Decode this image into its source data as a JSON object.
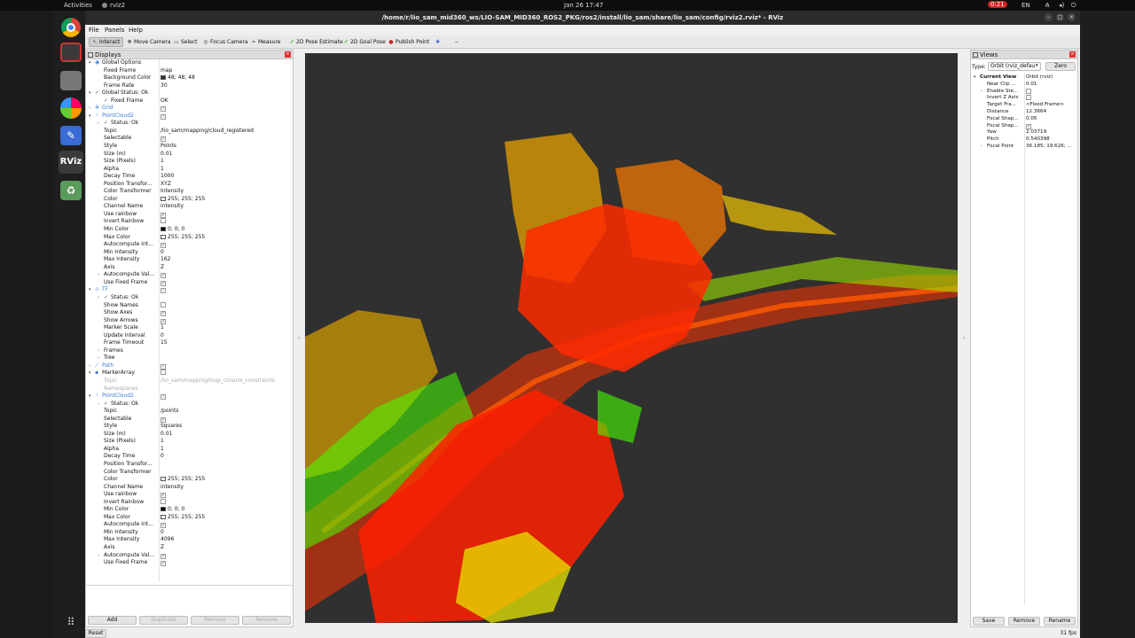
{
  "system": {
    "activities": "Activities",
    "app_name": "rviz2",
    "datetime": "Jan 26  17:47",
    "recording": "0:21",
    "language": "EN"
  },
  "window": {
    "title": "/home/r/lio_sam_mid360_ws/LIO-SAM_MID360_ROS2_PKG/ros2/install/lio_sam/share/lio_sam/config/rviz2.rviz* - RViz"
  },
  "menu": [
    "File",
    "Panels",
    "Help"
  ],
  "toolbar": [
    {
      "label": "Interact",
      "icon": "interact-icon",
      "active": true
    },
    {
      "label": "Move Camera",
      "icon": "move-camera-icon",
      "active": false
    },
    {
      "label": "Select",
      "icon": "select-icon",
      "active": false
    },
    {
      "label": "Focus Camera",
      "icon": "focus-camera-icon",
      "active": false
    },
    {
      "label": "Measure",
      "icon": "measure-icon",
      "active": false
    },
    {
      "label": "2D Pose Estimate",
      "icon": "pose-estimate-icon",
      "active": false
    },
    {
      "label": "2D Goal Pose",
      "icon": "goal-pose-icon",
      "active": false
    },
    {
      "label": "Publish Point",
      "icon": "publish-point-icon",
      "active": false
    }
  ],
  "displays": {
    "title": "Displays",
    "rows": [
      {
        "d": 0,
        "exp": "v",
        "icon": "globe-icon",
        "k": "Global Options",
        "v": ""
      },
      {
        "d": 1,
        "k": "Fixed Frame",
        "v": "map"
      },
      {
        "d": 1,
        "k": "Background Color",
        "v": "48; 48; 48",
        "sw": "#303030"
      },
      {
        "d": 1,
        "k": "Frame Rate",
        "v": "30"
      },
      {
        "d": 0,
        "exp": "v",
        "icon": "check-icon",
        "k": "Global Status: Ok",
        "v": ""
      },
      {
        "d": 1,
        "icon": "check-icon",
        "k": "Fixed Frame",
        "v": "OK"
      },
      {
        "d": 0,
        "exp": ">",
        "icon": "grid-icon",
        "k": "Grid",
        "v": "",
        "blue": true,
        "chk": true
      },
      {
        "d": 0,
        "exp": "v",
        "icon": "pointcloud-icon",
        "k": "PointCloud2",
        "v": "",
        "blue": true,
        "chk": true
      },
      {
        "d": 1,
        "exp": ">",
        "icon": "check-icon",
        "k": "Status: Ok",
        "v": ""
      },
      {
        "d": 1,
        "k": "Topic",
        "v": "/lio_sam/mapping/cloud_registered"
      },
      {
        "d": 1,
        "k": "Selectable",
        "v": "",
        "chk": true
      },
      {
        "d": 1,
        "k": "Style",
        "v": "Points"
      },
      {
        "d": 1,
        "k": "Size (m)",
        "v": "0.01"
      },
      {
        "d": 1,
        "k": "Size (Pixels)",
        "v": "1"
      },
      {
        "d": 1,
        "k": "Alpha",
        "v": "1"
      },
      {
        "d": 1,
        "k": "Decay Time",
        "v": "1000"
      },
      {
        "d": 1,
        "k": "Position Transfor...",
        "v": "XYZ"
      },
      {
        "d": 1,
        "k": "Color Transformer",
        "v": "Intensity"
      },
      {
        "d": 1,
        "k": "Color",
        "v": "255; 255; 255",
        "sw": "#ffffff"
      },
      {
        "d": 1,
        "k": "Channel Name",
        "v": "intensity"
      },
      {
        "d": 1,
        "k": "Use rainbow",
        "v": "",
        "chk": true
      },
      {
        "d": 1,
        "k": "Invert Rainbow",
        "v": "",
        "chk": false
      },
      {
        "d": 1,
        "k": "Min Color",
        "v": "0; 0; 0",
        "sw": "#000000"
      },
      {
        "d": 1,
        "k": "Max Color",
        "v": "255; 255; 255",
        "sw": "#ffffff"
      },
      {
        "d": 1,
        "k": "Autocompute Int...",
        "v": "",
        "chk": true
      },
      {
        "d": 1,
        "k": "Min Intensity",
        "v": "0"
      },
      {
        "d": 1,
        "k": "Max Intensity",
        "v": "162"
      },
      {
        "d": 1,
        "k": "Axis",
        "v": "Z"
      },
      {
        "d": 1,
        "exp": ">",
        "k": "Autocompute Val...",
        "v": "",
        "chk": true
      },
      {
        "d": 1,
        "k": "Use Fixed Frame",
        "v": "",
        "chk": true
      },
      {
        "d": 0,
        "exp": "v",
        "icon": "tf-icon",
        "k": "TF",
        "v": "",
        "blue": true,
        "chk": true
      },
      {
        "d": 1,
        "exp": ">",
        "icon": "check-icon",
        "k": "Status: Ok",
        "v": ""
      },
      {
        "d": 1,
        "k": "Show Names",
        "v": "",
        "chk": false
      },
      {
        "d": 1,
        "k": "Show Axes",
        "v": "",
        "chk": true
      },
      {
        "d": 1,
        "k": "Show Arrows",
        "v": "",
        "chk": true
      },
      {
        "d": 1,
        "k": "Marker Scale",
        "v": "1"
      },
      {
        "d": 1,
        "k": "Update Interval",
        "v": "0"
      },
      {
        "d": 1,
        "k": "Frame Timeout",
        "v": "15"
      },
      {
        "d": 1,
        "exp": ">",
        "k": "Frames",
        "v": ""
      },
      {
        "d": 1,
        "exp": ">",
        "k": "Tree",
        "v": ""
      },
      {
        "d": 0,
        "exp": ">",
        "icon": "path-icon",
        "k": "Path",
        "v": "",
        "blue": true,
        "chk": true
      },
      {
        "d": 0,
        "exp": "v",
        "icon": "marker-icon",
        "k": "MarkerArray",
        "v": "",
        "chk": false
      },
      {
        "d": 1,
        "k": "Topic",
        "v": "/lio_sam/mapping/loop_closure_constraints",
        "gray": true
      },
      {
        "d": 1,
        "k": "Namespaces",
        "v": "",
        "gray": true
      },
      {
        "d": 0,
        "exp": "v",
        "icon": "pointcloud-icon",
        "k": "PointCloud2",
        "v": "",
        "blue": true,
        "chk": true
      },
      {
        "d": 1,
        "exp": ">",
        "icon": "check-icon",
        "k": "Status: Ok",
        "v": ""
      },
      {
        "d": 1,
        "k": "Topic",
        "v": "/points"
      },
      {
        "d": 1,
        "k": "Selectable",
        "v": "",
        "chk": true
      },
      {
        "d": 1,
        "k": "Style",
        "v": "Squares"
      },
      {
        "d": 1,
        "k": "Size (m)",
        "v": "0.01"
      },
      {
        "d": 1,
        "k": "Size (Pixels)",
        "v": "1"
      },
      {
        "d": 1,
        "k": "Alpha",
        "v": "1"
      },
      {
        "d": 1,
        "k": "Decay Time",
        "v": "0"
      },
      {
        "d": 1,
        "k": "Position Transfor...",
        "v": ""
      },
      {
        "d": 1,
        "k": "Color Transformer",
        "v": ""
      },
      {
        "d": 1,
        "k": "Color",
        "v": "255; 255; 255",
        "sw": "#ffffff"
      },
      {
        "d": 1,
        "k": "Channel Name",
        "v": "intensity"
      },
      {
        "d": 1,
        "k": "Use rainbow",
        "v": "",
        "chk": true
      },
      {
        "d": 1,
        "k": "Invert Rainbow",
        "v": "",
        "chk": false
      },
      {
        "d": 1,
        "k": "Min Color",
        "v": "0; 0; 0",
        "sw": "#000000"
      },
      {
        "d": 1,
        "k": "Max Color",
        "v": "255; 255; 255",
        "sw": "#ffffff"
      },
      {
        "d": 1,
        "k": "Autocompute Int...",
        "v": "",
        "chk": true
      },
      {
        "d": 1,
        "k": "Min Intensity",
        "v": "0"
      },
      {
        "d": 1,
        "k": "Max Intensity",
        "v": "4096"
      },
      {
        "d": 1,
        "k": "Axis",
        "v": "Z"
      },
      {
        "d": 1,
        "exp": ">",
        "k": "Autocompute Val...",
        "v": "",
        "chk": true
      },
      {
        "d": 1,
        "k": "Use Fixed Frame",
        "v": "",
        "chk": true
      }
    ],
    "buttons": {
      "add": "Add",
      "duplicate": "Duplicate",
      "remove": "Remove",
      "rename": "Rename"
    }
  },
  "views": {
    "title": "Views",
    "type_label": "Type:",
    "type_value": "Orbit (rviz_defau",
    "zero": "Zero",
    "rows": [
      {
        "d": 0,
        "exp": "v",
        "k": "Current View",
        "v": "Orbit (rviz)",
        "bold": true
      },
      {
        "d": 1,
        "k": "Near Clip ...",
        "v": "0.01"
      },
      {
        "d": 1,
        "exp": ">",
        "k": "Enable Ste...",
        "v": "",
        "chk": false
      },
      {
        "d": 1,
        "k": "Invert Z Axis",
        "v": "",
        "chk": false
      },
      {
        "d": 1,
        "k": "Target Fra...",
        "v": "<Fixed Frame>"
      },
      {
        "d": 1,
        "k": "Distance",
        "v": "12.3664"
      },
      {
        "d": 1,
        "k": "Focal Shap...",
        "v": "0.05"
      },
      {
        "d": 1,
        "k": "Focal Shap...",
        "v": "",
        "chk": true
      },
      {
        "d": 1,
        "k": "Yaw",
        "v": "2.03719"
      },
      {
        "d": 1,
        "k": "Pitch",
        "v": "0.540398"
      },
      {
        "d": 1,
        "exp": ">",
        "k": "Focal Point",
        "v": "36.185; 19.626; ..."
      }
    ],
    "buttons": {
      "save": "Save",
      "remove": "Remove",
      "rename": "Rename"
    }
  },
  "status": {
    "reset": "Reset",
    "fps": "31 fps"
  },
  "colors": {
    "background": "#303030",
    "cloud_red": "#ff2a00",
    "cloud_orange": "#ff8c00",
    "cloud_yellow": "#e6e600",
    "cloud_green": "#46ff00"
  }
}
